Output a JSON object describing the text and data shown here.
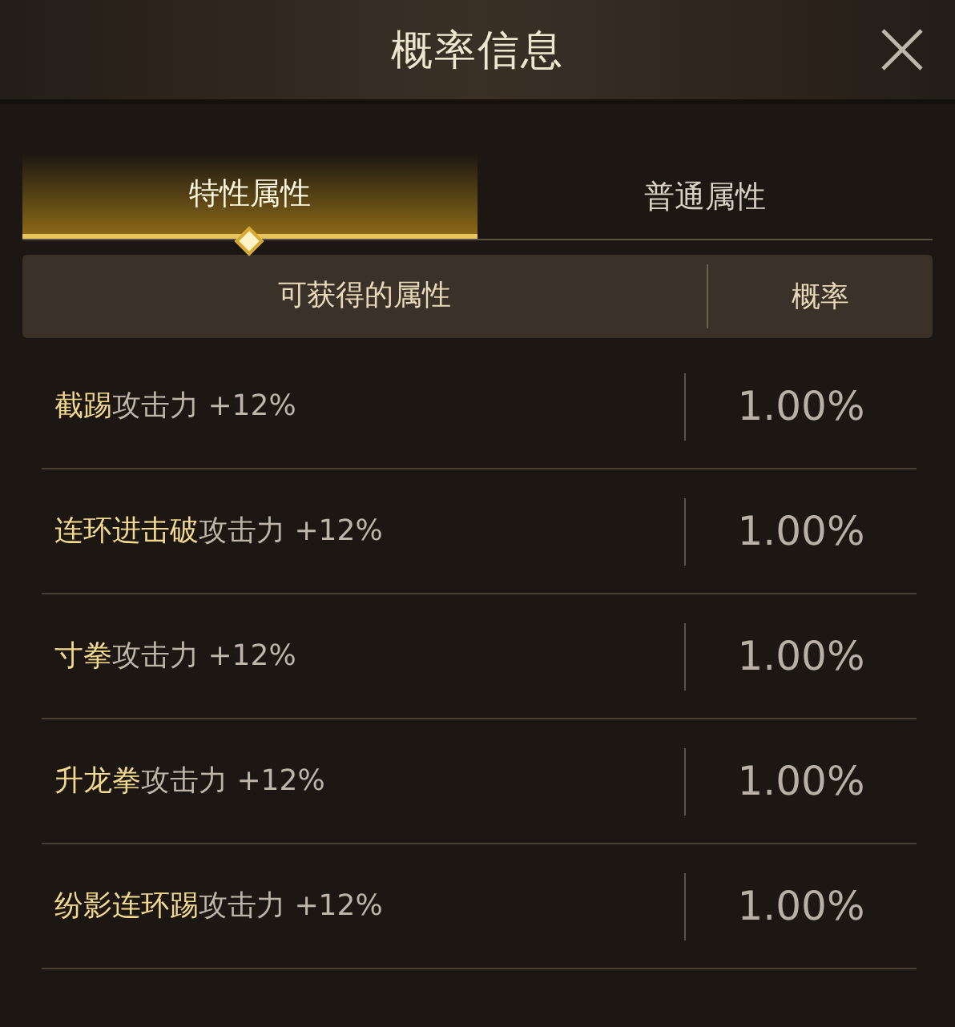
{
  "window": {
    "title": "概率信息"
  },
  "tabs": [
    {
      "label": "特性属性",
      "selected": true
    },
    {
      "label": "普通属性",
      "selected": false
    }
  ],
  "table": {
    "columns": [
      "可获得的属性",
      "概率"
    ],
    "rows": [
      {
        "skill": "截踢",
        "effect": "攻击力 +12%",
        "rate": "1.00%"
      },
      {
        "skill": "连环进击破",
        "effect": "攻击力 +12%",
        "rate": "1.00%"
      },
      {
        "skill": "寸拳",
        "effect": "攻击力 +12%",
        "rate": "1.00%"
      },
      {
        "skill": "升龙拳",
        "effect": "攻击力 +12%",
        "rate": "1.00%"
      },
      {
        "skill": "纷影连环踢",
        "effect": "攻击力 +12%",
        "rate": "1.00%"
      }
    ]
  }
}
